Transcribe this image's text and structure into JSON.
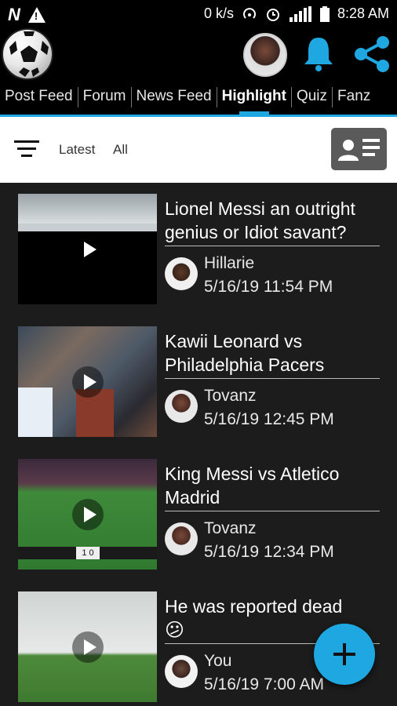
{
  "status_bar": {
    "network": "0 k/s",
    "time": "8:28 AM",
    "left_icons": [
      "n-icon",
      "warning-icon"
    ],
    "right_icons": [
      "hotspot-icon",
      "alarm-icon",
      "signal-icon",
      "battery-icon"
    ]
  },
  "app_bar": {
    "logo_icon": "soccer-ball-icon",
    "actions": [
      "profile-avatar",
      "bell-icon",
      "share-icon"
    ],
    "accent": "#1ea7e1"
  },
  "tabs": [
    {
      "label": "Post Feed",
      "active": false
    },
    {
      "label": "Forum",
      "active": false
    },
    {
      "label": "News Feed",
      "active": false
    },
    {
      "label": "Highlight",
      "active": true
    },
    {
      "label": "Quiz",
      "active": false
    },
    {
      "label": "Fanz",
      "active": false
    }
  ],
  "filter": {
    "sort_label": "Latest",
    "scope_label": "All",
    "filter_icon": "filter-icon",
    "contact_icon": "contact-card-icon"
  },
  "posts": [
    {
      "title": "Lionel Messi an outright genius or Idiot savant?",
      "author": "Hillarie",
      "date": "5/16/19 11:54 PM"
    },
    {
      "title": "Kawii Leonard vs Philadelphia Pacers",
      "author": "Tovanz",
      "date": "5/16/19 12:45 PM"
    },
    {
      "title": "King Messi vs Atletico Madrid",
      "author": "Tovanz",
      "date": "5/16/19 12:34 PM",
      "scoreboard": "1 0"
    },
    {
      "title": "He was reported dead",
      "emoji": "😕",
      "author": "You",
      "date": "5/16/19 7:00 AM"
    }
  ],
  "fab_icon": "plus-icon"
}
